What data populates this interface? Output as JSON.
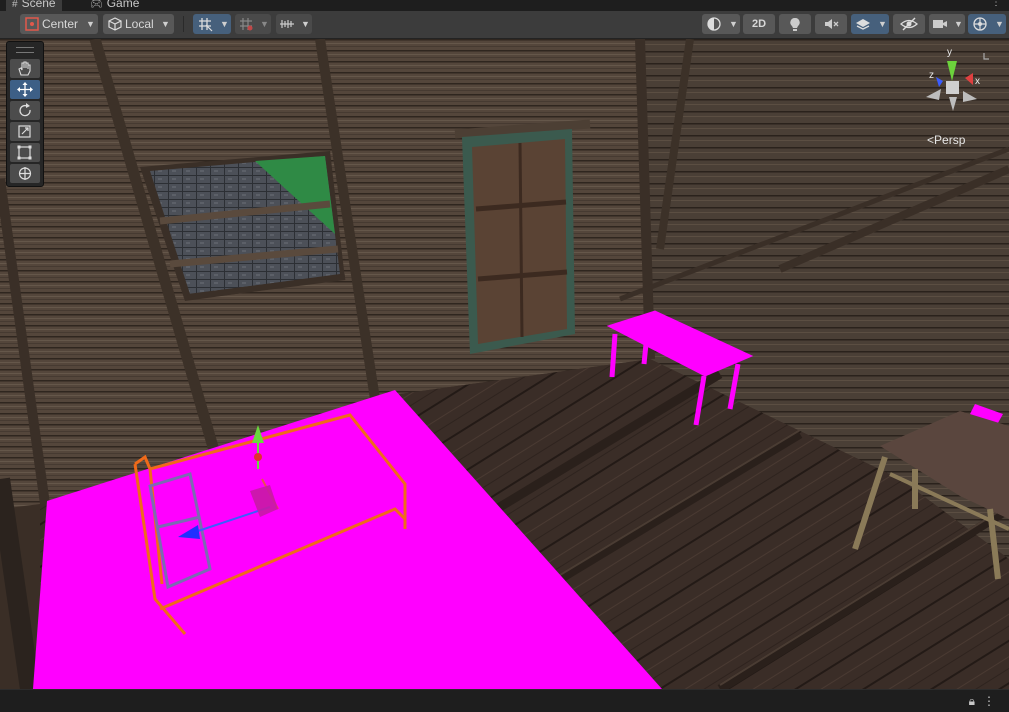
{
  "tabs": [
    {
      "label": "Scene",
      "icon": "hash-icon",
      "active": true
    },
    {
      "label": "Game",
      "icon": "gamepad-icon",
      "active": false
    }
  ],
  "toolbar": {
    "pivot_mode": "Center",
    "pivot_rotation": "Local",
    "toggle_2d": "2D"
  },
  "tools": [
    {
      "name": "hand-tool",
      "icon": "hand-icon"
    },
    {
      "name": "move-tool",
      "icon": "move-icon",
      "active": true
    },
    {
      "name": "rotate-tool",
      "icon": "rotate-icon"
    },
    {
      "name": "scale-tool",
      "icon": "scale-icon"
    },
    {
      "name": "rect-tool",
      "icon": "rect-icon"
    },
    {
      "name": "transform-tool",
      "icon": "transform-icon"
    }
  ],
  "gizmo": {
    "x": "x",
    "y": "y",
    "z": "z",
    "projection": "Persp"
  },
  "colors": {
    "accent": "#3d5f86",
    "missing_material": "#ff00ff",
    "selection_outline": "#f06a1a"
  }
}
